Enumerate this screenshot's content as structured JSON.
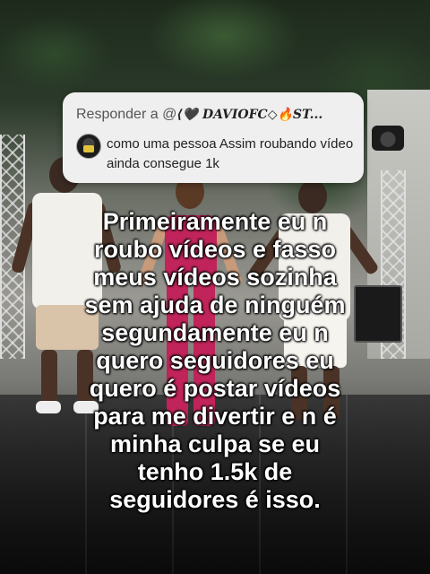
{
  "reply": {
    "prefix": "Responder a @",
    "username": "⟨🖤 DAVIOFC◇🔥ST...",
    "comment": "como uma pessoa Assim roubando vídeo ainda consegue 1k"
  },
  "caption": {
    "lines": [
      "Primeiramente eu n",
      "roubo vídeos e fasso",
      "meus vídeos sozinha",
      "sem ajuda de ninguém",
      "segundamente eu n",
      "quero seguidores eu",
      "quero é postar vídeos",
      "para me divertir e n é",
      "minha culpa se eu",
      "tenho 1.5k de",
      "seguidores é isso."
    ]
  },
  "colors": {
    "card_bg": "#efefef",
    "caption_text": "#ffffff",
    "dancer_center_outfit": "#c0245a",
    "dancer_side_outfit": "#f2f0ea"
  }
}
